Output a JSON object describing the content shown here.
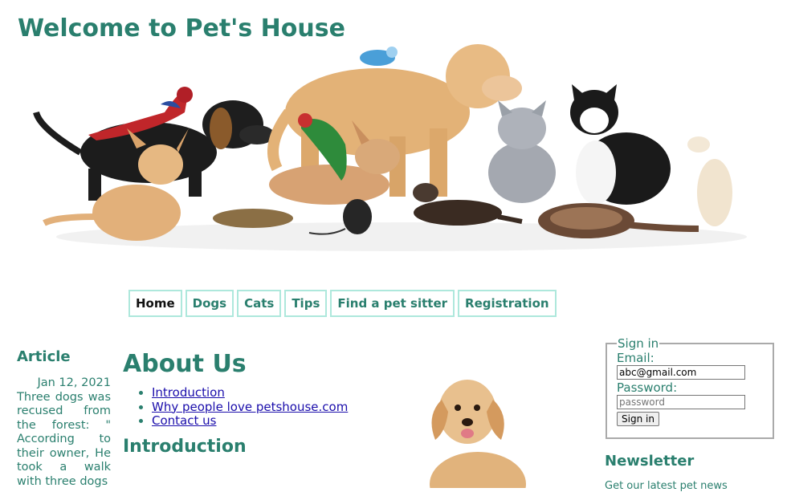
{
  "header": {
    "title": "Welcome to Pet's House"
  },
  "nav": {
    "items": [
      {
        "label": "Home"
      },
      {
        "label": "Dogs"
      },
      {
        "label": "Cats"
      },
      {
        "label": "Tips"
      },
      {
        "label": "Find a pet sitter"
      },
      {
        "label": "Registration"
      }
    ],
    "active": "Home"
  },
  "article": {
    "heading": "Article",
    "date": "Jan 12, 2021",
    "body": "Three dogs was recused from the forest: \" According to their owner, He took a walk with three dogs"
  },
  "main": {
    "heading": "About Us",
    "links": [
      {
        "label": "Introduction"
      },
      {
        "label": "Why people love petshouse.com"
      },
      {
        "label": "Contact us"
      }
    ],
    "section_heading": "Introduction"
  },
  "signin": {
    "legend": "Sign in",
    "email_label": "Email:",
    "email_value": "abc@gmail.com",
    "password_label": "Password:",
    "password_placeholder": "password",
    "button_label": "Sign in"
  },
  "newsletter": {
    "heading": "Newsletter",
    "text": "Get our latest pet news"
  },
  "colors": {
    "accent": "#2a7f6e",
    "link": "#1a0dab",
    "nav_border": "#aee8dc"
  }
}
